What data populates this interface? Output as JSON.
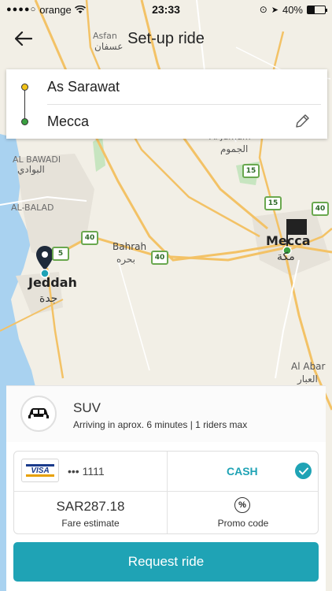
{
  "status_bar": {
    "carrier": "orange",
    "time": "23:33",
    "battery": "40%",
    "battery_level": 0.4
  },
  "header": {
    "title": "Set-up ride"
  },
  "route": {
    "from": "As Sarawat",
    "to": "Mecca"
  },
  "map": {
    "cities": {
      "jeddah": "Jeddah",
      "jeddah_ar": "جدة",
      "mecca": "Mecca",
      "mecca_ar": "مكة"
    },
    "places": {
      "asfan": "Asfan",
      "asfan_ar": "عسفان",
      "al_bawadi": "AL BAWADI",
      "al_bawadi_ar": "البوادي",
      "al_balad": "AL-BALAD",
      "bahrah": "Bahrah",
      "bahrah_ar": "بحره",
      "al_jumum": "Al Jumum",
      "al_jumum_ar": "الجموم",
      "al_abar": "Al Abar",
      "al_abar_ar": "العبار"
    },
    "shields": {
      "r15a": "15",
      "r15b": "15",
      "r40a": "40",
      "r40b": "40",
      "r40c": "40",
      "r5": "5"
    }
  },
  "vehicle": {
    "name": "SUV",
    "eta": "Arriving in aprox. 6 minutes | 1 riders max",
    "icon": "car-icon"
  },
  "payment": {
    "card_brand": "VISA",
    "card_masked": "••• 1111",
    "cash_label": "CASH",
    "cash_selected": true
  },
  "fare": {
    "amount": "SAR287.18",
    "label": "Fare estimate"
  },
  "promo": {
    "label": "Promo code",
    "icon": "percent-icon"
  },
  "request_button": {
    "label": "Request ride"
  },
  "colors": {
    "accent": "#1fa3b5",
    "origin_dot": "#f2c318",
    "destination_dot": "#3aa040"
  }
}
